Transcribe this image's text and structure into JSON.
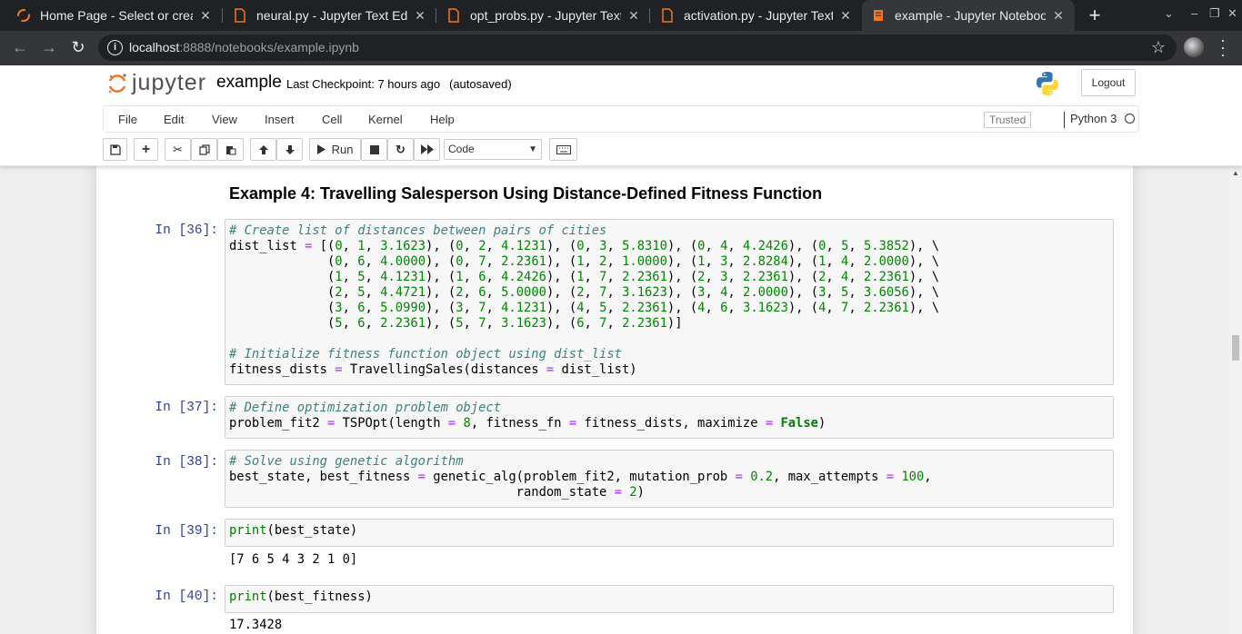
{
  "browser": {
    "tabs": [
      {
        "title": "Home Page - Select or create",
        "icon": "jupyter-icon",
        "close": "✕"
      },
      {
        "title": "neural.py - Jupyter Text Editor",
        "icon": "file-icon",
        "close": "✕"
      },
      {
        "title": "opt_probs.py - Jupyter Text Editor",
        "icon": "file-icon",
        "close": "✕"
      },
      {
        "title": "activation.py - Jupyter Text Editor",
        "icon": "file-icon",
        "close": "✕"
      },
      {
        "title": "example - Jupyter Notebook",
        "icon": "notebook-icon",
        "close": "✕",
        "active": true
      }
    ],
    "new_tab": "+",
    "window_controls": [
      "⌄",
      "–",
      "❐",
      "✕"
    ],
    "url_host": "localhost",
    "url_rest": ":8888/notebooks/example.ipynb"
  },
  "jupyter": {
    "logo_text": "jupyter",
    "notebook_name": "example",
    "checkpoint": "Last Checkpoint: 7 hours ago",
    "autosave": "(autosaved)",
    "logout": "Logout",
    "menu": [
      "File",
      "Edit",
      "View",
      "Insert",
      "Cell",
      "Kernel",
      "Help"
    ],
    "trusted": "Trusted",
    "kernel": "Python 3",
    "run_label": "Run",
    "cell_type": "Code"
  },
  "notebook": {
    "heading": "Example 4: Travelling Salesperson Using Distance-Defined Fitness Function",
    "cells": [
      {
        "prompt": "In [36]:"
      },
      {
        "prompt": "In [37]:"
      },
      {
        "prompt": "In [38]:"
      },
      {
        "prompt": "In [39]:",
        "output": "[7 6 5 4 3 2 1 0]"
      },
      {
        "prompt": "In [40]:",
        "output": "17.3428"
      }
    ]
  },
  "colors": {
    "accent_orange": "#f37726",
    "prompt_blue": "#303f9f",
    "comment": "#408080",
    "number": "#008800",
    "operator": "#aa22ff"
  }
}
